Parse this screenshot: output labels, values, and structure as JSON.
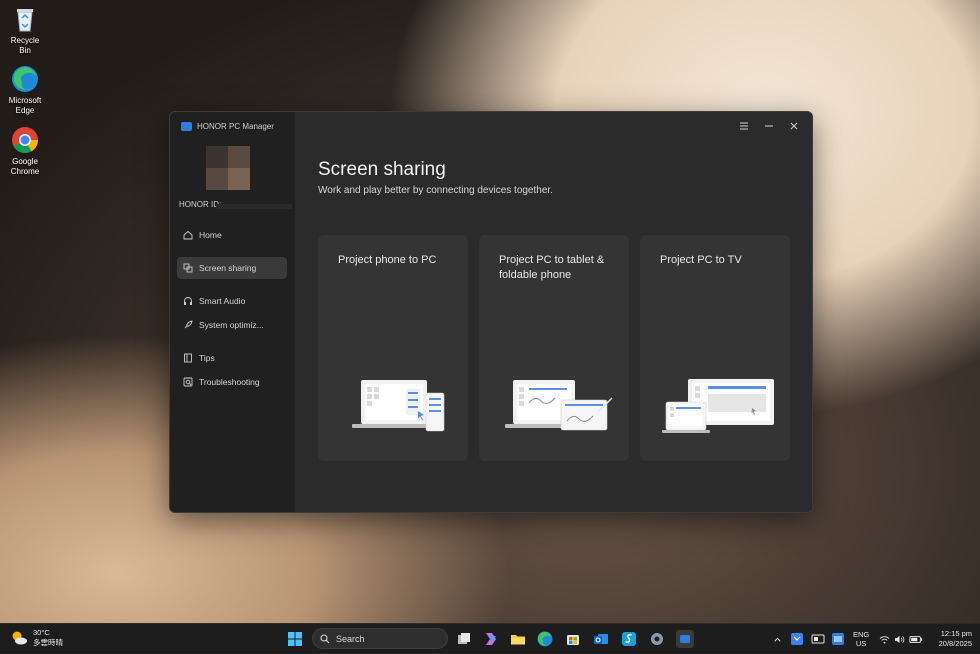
{
  "desktop": {
    "icons": [
      {
        "label": "Recycle Bin"
      },
      {
        "label": "Microsoft Edge"
      },
      {
        "label": "Google Chrome"
      }
    ]
  },
  "app": {
    "title": "HONOR PC Manager",
    "honor_id_label": "HONOR ID:",
    "nav": [
      {
        "label": "Home",
        "icon": "home-icon"
      },
      {
        "label": "Screen sharing",
        "icon": "screen-share-icon",
        "active": true
      },
      {
        "label": "Smart Audio",
        "icon": "headphones-icon"
      },
      {
        "label": "System optimiz...",
        "icon": "rocket-icon"
      },
      {
        "label": "Tips",
        "icon": "book-icon"
      },
      {
        "label": "Troubleshooting",
        "icon": "troubleshoot-icon"
      }
    ],
    "page": {
      "title": "Screen sharing",
      "subtitle": "Work and play better by connecting devices together."
    },
    "cards": [
      {
        "title": "Project phone to PC"
      },
      {
        "title": "Project PC to tablet & foldable phone"
      },
      {
        "title": "Project PC to TV"
      }
    ],
    "colors": {
      "accent": "#5b8fe6",
      "sidebar_bg": "#202020",
      "main_bg": "#2b2b2b",
      "card_bg": "#343434"
    }
  },
  "taskbar": {
    "weather": {
      "temp": "30°C",
      "desc": "多雲時晴"
    },
    "search_label": "Search",
    "lang": {
      "line1": "ENG",
      "line2": "US"
    },
    "clock": {
      "time": "12:15 pm",
      "date": "20/8/2025"
    }
  }
}
